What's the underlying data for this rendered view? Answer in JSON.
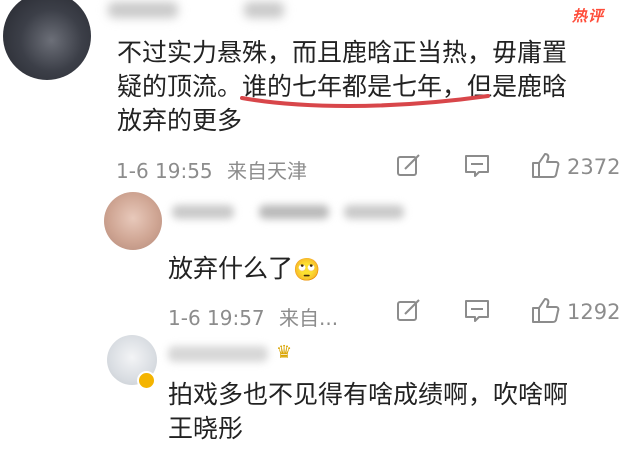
{
  "header": {
    "hot_label": "热评"
  },
  "comments": [
    {
      "username": "",
      "text_line1": "不过实力悬殊，而且鹿晗正当热，毋庸置",
      "text_line2_a": "疑的顶流。",
      "text_line2_b": "谁的七年都是七年",
      "text_line2_c": "，但是鹿晗",
      "text_line3": "放弃的更多",
      "date": "1-6 19:55",
      "location": "来自天津",
      "likes": "2372"
    },
    {
      "username": "",
      "text": "放弃什么了",
      "emoji": "🙄",
      "date": "1-6 19:57",
      "location": "来自...",
      "likes": "1292"
    },
    {
      "username": "",
      "text_line1": "拍戏多也不见得有啥成绩啊，吹啥啊",
      "text_line2": "王晓彤"
    }
  ],
  "colors": {
    "hot": "#ff4d3a",
    "underline": "#d8464a",
    "meta": "#8c8c8c"
  },
  "icons": [
    "share-icon",
    "comment-icon",
    "like-icon",
    "crown-icon"
  ]
}
